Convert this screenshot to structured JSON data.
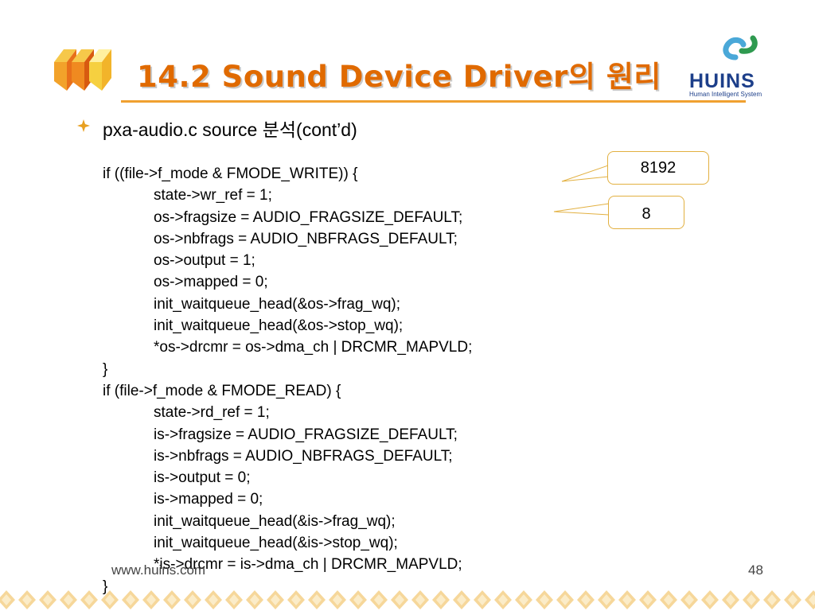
{
  "slide": {
    "title": "14.2  Sound Device Driver의 원리",
    "subtitle": "pxa-audio.c source 분석(cont’d)",
    "brand": {
      "name": "HUINS",
      "tagline": "Human Intelligent System",
      "accent_color": "#e06a00",
      "brand_color": "#1d3f8a"
    },
    "code_lines": [
      {
        "indent": false,
        "text": "if ((file->f_mode & FMODE_WRITE)) {"
      },
      {
        "indent": true,
        "text": "state->wr_ref = 1;"
      },
      {
        "indent": true,
        "text": "os->fragsize = AUDIO_FRAGSIZE_DEFAULT;"
      },
      {
        "indent": true,
        "text": "os->nbfrags = AUDIO_NBFRAGS_DEFAULT;"
      },
      {
        "indent": true,
        "text": "os->output = 1;"
      },
      {
        "indent": true,
        "text": "os->mapped = 0;"
      },
      {
        "indent": true,
        "text": "init_waitqueue_head(&os->frag_wq);"
      },
      {
        "indent": true,
        "text": "init_waitqueue_head(&os->stop_wq);"
      },
      {
        "indent": true,
        "text": "*os->drcmr = os->dma_ch | DRCMR_MAPVLD;"
      },
      {
        "indent": false,
        "text": "}"
      },
      {
        "indent": false,
        "text": "if (file->f_mode & FMODE_READ) {"
      },
      {
        "indent": true,
        "text": "state->rd_ref = 1;"
      },
      {
        "indent": true,
        "text": "is->fragsize = AUDIO_FRAGSIZE_DEFAULT;"
      },
      {
        "indent": true,
        "text": "is->nbfrags = AUDIO_NBFRAGS_DEFAULT;"
      },
      {
        "indent": true,
        "text": "is->output = 0;"
      },
      {
        "indent": true,
        "text": "is->mapped = 0;"
      },
      {
        "indent": true,
        "text": "init_waitqueue_head(&is->frag_wq);"
      },
      {
        "indent": true,
        "text": "init_waitqueue_head(&is->stop_wq);"
      },
      {
        "indent": true,
        "text": "*is->drcmr = is->dma_ch | DRCMR_MAPVLD;"
      },
      {
        "indent": false,
        "text": "}"
      }
    ],
    "callouts": [
      {
        "text": "8192"
      },
      {
        "text": "8"
      }
    ],
    "footer_url": "www.huins.com",
    "page_number": "48"
  }
}
